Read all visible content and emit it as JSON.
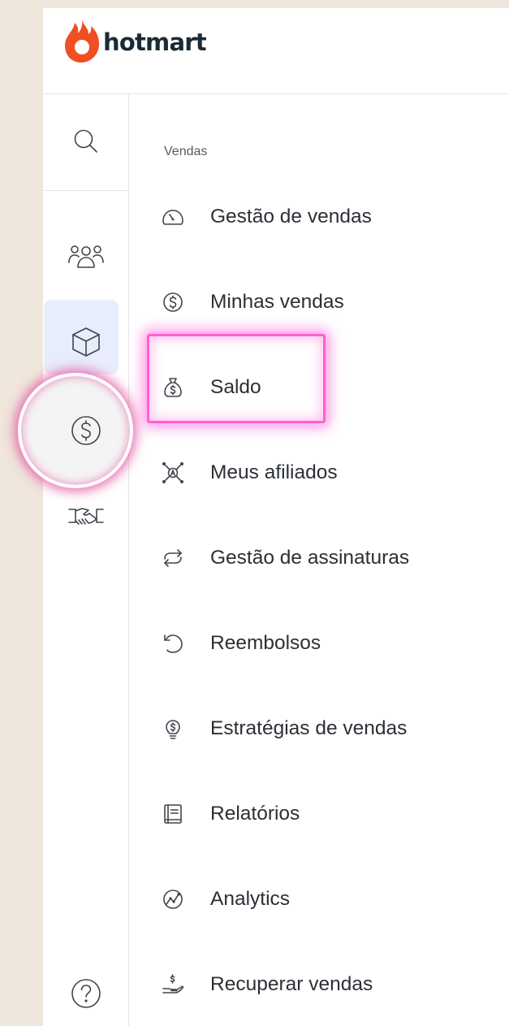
{
  "brand": {
    "name": "hotmart",
    "color": "#f04e23"
  },
  "rail": {
    "icons": [
      "search-icon",
      "users-icon",
      "box-icon",
      "dollar-circle-icon",
      "handshake-icon",
      "help-icon"
    ]
  },
  "menu": {
    "section_title": "Vendas",
    "items": [
      {
        "label": "Gestão de vendas",
        "icon": "gauge-icon"
      },
      {
        "label": "Minhas vendas",
        "icon": "dollar-circle-icon"
      },
      {
        "label": "Saldo",
        "icon": "money-bag-icon"
      },
      {
        "label": "Meus afiliados",
        "icon": "affiliates-network-icon"
      },
      {
        "label": "Gestão de assinaturas",
        "icon": "repeat-icon"
      },
      {
        "label": "Reembolsos",
        "icon": "undo-icon"
      },
      {
        "label": "Estratégias de vendas",
        "icon": "lightbulb-dollar-icon"
      },
      {
        "label": "Relatórios",
        "icon": "report-book-icon"
      },
      {
        "label": "Analytics",
        "icon": "analytics-chart-icon"
      },
      {
        "label": "Recuperar vendas",
        "icon": "hand-dollar-icon"
      }
    ]
  },
  "colors": {
    "highlight": "#ff5fd2",
    "active_bg": "#e8edfb",
    "page_bg": "#efe6dc"
  }
}
